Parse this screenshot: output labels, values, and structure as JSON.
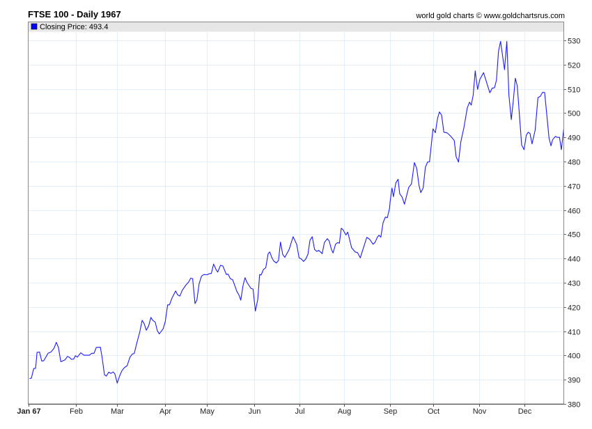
{
  "chart_data": {
    "type": "line",
    "title": "FTSE 100 - Daily 1967",
    "credit": "world gold charts © www.goldchartsrus.com",
    "legend": {
      "label": "Closing Price: 493.4",
      "position": "top-left",
      "color": "#0000ff"
    },
    "line_color": "#1a1aff",
    "xlabel": "",
    "ylabel": "",
    "ylim": [
      380,
      535
    ],
    "xlim_days": [
      0,
      365.5
    ],
    "grid": true,
    "y_ticks": [
      380,
      390,
      400,
      410,
      420,
      430,
      440,
      450,
      460,
      470,
      480,
      490,
      500,
      510,
      520,
      530
    ],
    "x_ticks": [
      {
        "label": "Jan 67",
        "day": 0,
        "bold": true
      },
      {
        "label": "Feb",
        "day": 32.3
      },
      {
        "label": "Mar",
        "day": 60.4
      },
      {
        "label": "Apr",
        "day": 93.2
      },
      {
        "label": "May",
        "day": 121.7
      },
      {
        "label": "Jun",
        "day": 154
      },
      {
        "label": "Jul",
        "day": 184.9
      },
      {
        "label": "Aug",
        "day": 215.3
      },
      {
        "label": "Sep",
        "day": 246.7
      },
      {
        "label": "Oct",
        "day": 276.1
      },
      {
        "label": "Nov",
        "day": 307.5
      },
      {
        "label": "Dec",
        "day": 338.4
      }
    ],
    "series": [
      {
        "name": "Closing Price",
        "points": [
          [
            0.6,
            390.5
          ],
          [
            1.9,
            390.6
          ],
          [
            3.5,
            394.6
          ],
          [
            4.8,
            394.7
          ],
          [
            5.8,
            401.3
          ],
          [
            7.5,
            401.4
          ],
          [
            9.0,
            397.7
          ],
          [
            10.3,
            397.8
          ],
          [
            13.3,
            400.9
          ],
          [
            15.4,
            401.5
          ],
          [
            17.4,
            403.0
          ],
          [
            18.9,
            405.4
          ],
          [
            20.4,
            403.3
          ],
          [
            22.0,
            397.4
          ],
          [
            24.9,
            398.2
          ],
          [
            26.5,
            399.6
          ],
          [
            28.0,
            399.2
          ],
          [
            29.3,
            398.4
          ],
          [
            30.8,
            398.5
          ],
          [
            32.0,
            399.9
          ],
          [
            33.3,
            399.3
          ],
          [
            35.6,
            401.1
          ],
          [
            37.9,
            400.1
          ],
          [
            41.5,
            400.1
          ],
          [
            43.1,
            400.9
          ],
          [
            44.7,
            400.9
          ],
          [
            46.2,
            403.3
          ],
          [
            49.0,
            403.4
          ],
          [
            50.2,
            399.2
          ],
          [
            51.8,
            392.0
          ],
          [
            53.1,
            391.5
          ],
          [
            54.7,
            393.1
          ],
          [
            56.2,
            392.6
          ],
          [
            57.7,
            393.2
          ],
          [
            58.9,
            392.4
          ],
          [
            60.5,
            388.6
          ],
          [
            62.1,
            391.5
          ],
          [
            63.7,
            393.7
          ],
          [
            65.3,
            394.9
          ],
          [
            67.3,
            395.8
          ],
          [
            69.2,
            399.3
          ],
          [
            70.8,
            400.6
          ],
          [
            72.1,
            400.8
          ],
          [
            74.0,
            405.4
          ],
          [
            75.9,
            409.7
          ],
          [
            77.5,
            414.5
          ],
          [
            79.0,
            413.0
          ],
          [
            80.3,
            410.4
          ],
          [
            81.9,
            412.1
          ],
          [
            83.5,
            415.7
          ],
          [
            84.7,
            414.5
          ],
          [
            86.4,
            413.8
          ],
          [
            87.9,
            410.2
          ],
          [
            89.2,
            408.9
          ],
          [
            91.9,
            411.1
          ],
          [
            93.3,
            414.0
          ],
          [
            94.9,
            420.9
          ],
          [
            96.2,
            420.9
          ],
          [
            97.8,
            423.6
          ],
          [
            100.4,
            426.6
          ],
          [
            101.7,
            425.0
          ],
          [
            103.3,
            424.5
          ],
          [
            104.9,
            426.9
          ],
          [
            107.3,
            429.0
          ],
          [
            109.2,
            430.3
          ],
          [
            110.7,
            431.9
          ],
          [
            112.0,
            431.7
          ],
          [
            113.6,
            421.4
          ],
          [
            114.9,
            422.9
          ],
          [
            116.4,
            429.6
          ],
          [
            118.0,
            432.7
          ],
          [
            119.6,
            433.4
          ],
          [
            122.0,
            433.3
          ],
          [
            123.4,
            433.8
          ],
          [
            124.7,
            433.8
          ],
          [
            126.3,
            437.7
          ],
          [
            127.9,
            435.5
          ],
          [
            129.1,
            434.4
          ],
          [
            131.0,
            437.2
          ],
          [
            132.6,
            436.9
          ],
          [
            135.0,
            433.4
          ],
          [
            136.1,
            433.6
          ],
          [
            137.7,
            431.7
          ],
          [
            139.3,
            431.2
          ],
          [
            142.1,
            426.5
          ],
          [
            143.7,
            424.8
          ],
          [
            144.8,
            422.8
          ],
          [
            146.4,
            428.9
          ],
          [
            147.7,
            432.1
          ],
          [
            149.2,
            430.0
          ],
          [
            151.9,
            427.6
          ],
          [
            153.2,
            427.4
          ],
          [
            154.8,
            418.3
          ],
          [
            156.4,
            423.1
          ],
          [
            157.7,
            433.4
          ],
          [
            158.7,
            433.2
          ],
          [
            160.3,
            435.5
          ],
          [
            161.9,
            436.2
          ],
          [
            163.5,
            442.0
          ],
          [
            164.6,
            442.7
          ],
          [
            166.2,
            440.1
          ],
          [
            167.4,
            438.9
          ],
          [
            169.1,
            438.2
          ],
          [
            170.6,
            439.2
          ],
          [
            171.9,
            446.8
          ],
          [
            173.5,
            441.6
          ],
          [
            174.9,
            440.5
          ],
          [
            177.8,
            443.7
          ],
          [
            180.5,
            449.0
          ],
          [
            183.0,
            445.9
          ],
          [
            184.6,
            440.3
          ],
          [
            186.0,
            439.9
          ],
          [
            187.7,
            438.8
          ],
          [
            189.3,
            439.9
          ],
          [
            190.7,
            441.8
          ],
          [
            192.0,
            447.5
          ],
          [
            193.6,
            449.0
          ],
          [
            195.2,
            443.7
          ],
          [
            196.8,
            442.9
          ],
          [
            198.0,
            443.4
          ],
          [
            200.4,
            442.0
          ],
          [
            201.9,
            446.6
          ],
          [
            203.9,
            448.2
          ],
          [
            205.2,
            447.2
          ],
          [
            206.7,
            443.7
          ],
          [
            207.8,
            442.3
          ],
          [
            209.5,
            445.9
          ],
          [
            211.0,
            446.6
          ],
          [
            212.1,
            446.3
          ],
          [
            213.4,
            452.5
          ],
          [
            214.7,
            451.8
          ],
          [
            216.6,
            449.7
          ],
          [
            217.8,
            450.9
          ],
          [
            220.5,
            444.4
          ],
          [
            222.9,
            442.7
          ],
          [
            224.5,
            442.4
          ],
          [
            226.4,
            440.3
          ],
          [
            228.5,
            444.4
          ],
          [
            230.8,
            448.7
          ],
          [
            232.7,
            448.0
          ],
          [
            235.1,
            445.9
          ],
          [
            236.4,
            446.6
          ],
          [
            238.0,
            448.8
          ],
          [
            239.1,
            449.6
          ],
          [
            240.4,
            448.8
          ],
          [
            241.9,
            454.7
          ],
          [
            243.5,
            457.1
          ],
          [
            244.8,
            456.8
          ],
          [
            246.3,
            460.5
          ],
          [
            246.7,
            463.3
          ],
          [
            248.0,
            469.1
          ],
          [
            249.0,
            465.5
          ],
          [
            250.6,
            471.2
          ],
          [
            252.2,
            472.7
          ],
          [
            253.3,
            466.7
          ],
          [
            254.9,
            465.4
          ],
          [
            256.5,
            462.4
          ],
          [
            259.4,
            469.3
          ],
          [
            261.3,
            470.8
          ],
          [
            263.3,
            479.6
          ],
          [
            264.9,
            477.2
          ],
          [
            266.5,
            470.0
          ],
          [
            267.7,
            467.2
          ],
          [
            269.3,
            469.1
          ],
          [
            270.8,
            477.7
          ],
          [
            272.3,
            479.8
          ],
          [
            273.6,
            479.9
          ],
          [
            276.0,
            493.5
          ],
          [
            277.6,
            491.9
          ],
          [
            279.1,
            497.8
          ],
          [
            280.4,
            500.5
          ],
          [
            281.9,
            499.1
          ],
          [
            283.4,
            492.1
          ],
          [
            285.5,
            491.9
          ],
          [
            287.9,
            490.6
          ],
          [
            290.5,
            488.7
          ],
          [
            291.8,
            482.0
          ],
          [
            293.4,
            479.8
          ],
          [
            295.0,
            488.2
          ],
          [
            297.1,
            494.0
          ],
          [
            299.4,
            502.1
          ],
          [
            300.9,
            504.5
          ],
          [
            302.1,
            503.3
          ],
          [
            303.4,
            507.4
          ],
          [
            304.8,
            517.4
          ],
          [
            306.4,
            509.8
          ],
          [
            308.0,
            513.9
          ],
          [
            310.5,
            516.7
          ],
          [
            314.8,
            508.4
          ],
          [
            316.4,
            510.3
          ],
          [
            318.0,
            510.5
          ],
          [
            319.3,
            513.6
          ],
          [
            320.7,
            525.6
          ],
          [
            322.1,
            529.6
          ],
          [
            324.8,
            517.9
          ],
          [
            326.4,
            529.6
          ],
          [
            327.8,
            507.4
          ],
          [
            329.4,
            497.3
          ],
          [
            330.7,
            504.5
          ],
          [
            332.2,
            514.4
          ],
          [
            333.5,
            511.2
          ],
          [
            336.5,
            486.8
          ],
          [
            338.1,
            484.9
          ],
          [
            339.7,
            490.9
          ],
          [
            340.9,
            492.1
          ],
          [
            342.2,
            491.6
          ],
          [
            343.6,
            487.3
          ],
          [
            345.7,
            493.0
          ],
          [
            347.6,
            506.4
          ],
          [
            349.2,
            506.9
          ],
          [
            350.8,
            508.6
          ],
          [
            352.2,
            508.5
          ],
          [
            355.2,
            489.7
          ],
          [
            356.5,
            486.5
          ],
          [
            357.6,
            489.0
          ],
          [
            359.5,
            490.4
          ],
          [
            360.7,
            490.0
          ],
          [
            362.3,
            490.0
          ],
          [
            363.6,
            484.9
          ],
          [
            365.2,
            493.4
          ]
        ]
      }
    ]
  }
}
